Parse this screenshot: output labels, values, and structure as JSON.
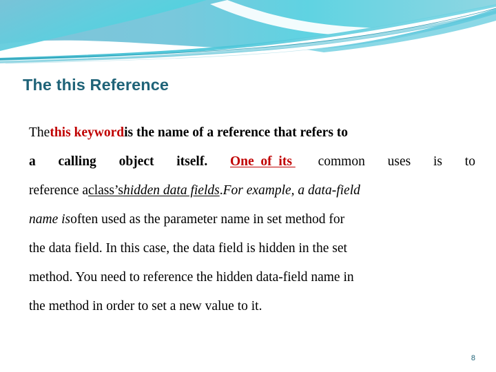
{
  "slide": {
    "title": "The this Reference",
    "page_number": "8",
    "colors": {
      "title": "#1F6378",
      "accent_red": "#C00000",
      "banner_blue": "#6FC4DC",
      "banner_teal": "#3FD0DC",
      "banner_deep": "#2BA8BF",
      "body_text": "#000000",
      "background": "#FFFFFF"
    },
    "banner": {
      "name": "decorative-wave-banner"
    },
    "body": {
      "lines": [
        {
          "id": "line-1",
          "segments": [
            {
              "text": "The ",
              "style": "regular"
            },
            {
              "text": "this keyword",
              "style": "bold-red"
            },
            {
              "text": " is the name of a reference that refers to",
              "style": "bold"
            }
          ]
        },
        {
          "id": "line-2",
          "segments": [
            {
              "text": "a  calling  object  itself.  ",
              "style": "bold"
            },
            {
              "text": "One  of  its ",
              "style": "bold-red-underline"
            },
            {
              "text": " common  uses  is  to",
              "style": "regular"
            }
          ]
        },
        {
          "id": "line-3",
          "segments": [
            {
              "text": "reference a ",
              "style": "regular"
            },
            {
              "text": "class’s ",
              "style": "underline"
            },
            {
              "text": "hidden data fields",
              "style": "italic-underline"
            },
            {
              "text": ". ",
              "style": "regular"
            },
            {
              "text": "For example, a data-field",
              "style": "italic"
            }
          ]
        },
        {
          "id": "line-4",
          "segments": [
            {
              "text": "name is",
              "style": "italic"
            },
            {
              "text": " often used as the parameter name in set method for",
              "style": "regular"
            }
          ]
        },
        {
          "id": "line-5",
          "segments": [
            {
              "text": "the data field. In this case, the data field is hidden in the set",
              "style": "regular"
            }
          ]
        },
        {
          "id": "line-6",
          "segments": [
            {
              "text": "method. You need to reference the hidden data-field name in",
              "style": "regular"
            }
          ]
        },
        {
          "id": "line-7",
          "segments": [
            {
              "text": "the method in order to set a new value to it.",
              "style": "regular"
            }
          ]
        }
      ],
      "line1_left": "The ",
      "line1_red": "this keyword",
      "line1_rest": " is the name of a reference that refers to",
      "line2_a": "a",
      "line2_b": "calling",
      "line2_c": "object",
      "line2_d": "itself.",
      "line2_red": "One  of  its ",
      "line2_e": "common",
      "line2_f": "uses",
      "line2_g": "is",
      "line2_h": "to",
      "line3_a": "reference a ",
      "line3_u1": "class’s ",
      "line3_u2": "hidden data fields",
      "line3_b": ". ",
      "line3_c": "For example, a data-field",
      "line4_a": "name is",
      "line4_b": " often used as the parameter name in set method for",
      "line5": "the data field. In this case, the data field is hidden in the set",
      "line6": "method. You need to reference the hidden data-field name in",
      "line7": "the method in order to set a new value to it."
    }
  }
}
